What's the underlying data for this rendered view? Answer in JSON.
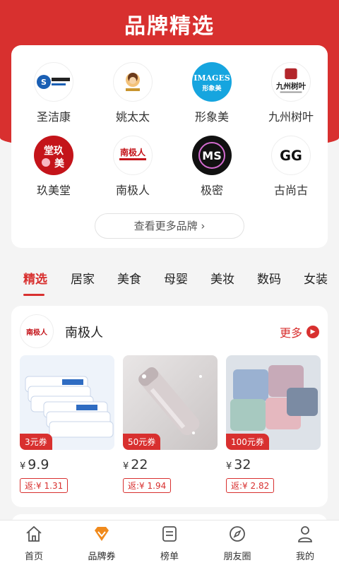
{
  "header": {
    "title": "品牌精选"
  },
  "brands": [
    {
      "name": "圣洁康",
      "logo_text": "S.J 圣洁康"
    },
    {
      "name": "姚太太",
      "logo_text": "姚太太"
    },
    {
      "name": "形象美",
      "logo_text": "IMAGES 形象美"
    },
    {
      "name": "九州树叶",
      "logo_text": "九州树叶"
    },
    {
      "name": "玖美堂",
      "logo_text": "堂玖美"
    },
    {
      "name": "南极人",
      "logo_text": "南极人 NANJIREN"
    },
    {
      "name": "极密",
      "logo_text": "MS"
    },
    {
      "name": "古尚古",
      "logo_text": "GG"
    }
  ],
  "more_brands": "查看更多品牌 ›",
  "tabs": [
    "精选",
    "居家",
    "美食",
    "母婴",
    "美妆",
    "数码",
    "女装"
  ],
  "shop": {
    "logo_text": "南极人",
    "name": "南极人",
    "more": "更多",
    "products": [
      {
        "coupon": "3元券",
        "yen": "¥",
        "price": "9.9",
        "rebate": "返:¥ 1.31"
      },
      {
        "coupon": "50元券",
        "yen": "¥",
        "price": "22",
        "rebate": "返:¥ 1.94"
      },
      {
        "coupon": "100元券",
        "yen": "¥",
        "price": "32",
        "rebate": "返:¥ 2.82"
      }
    ]
  },
  "nav": [
    {
      "label": "首页",
      "icon": "home-icon"
    },
    {
      "label": "品牌券",
      "icon": "diamond-icon"
    },
    {
      "label": "榜单",
      "icon": "list-icon"
    },
    {
      "label": "朋友圈",
      "icon": "compass-icon"
    },
    {
      "label": "我的",
      "icon": "user-icon"
    }
  ],
  "colors": {
    "accent": "#d8302f",
    "background": "#f4f4f4"
  }
}
